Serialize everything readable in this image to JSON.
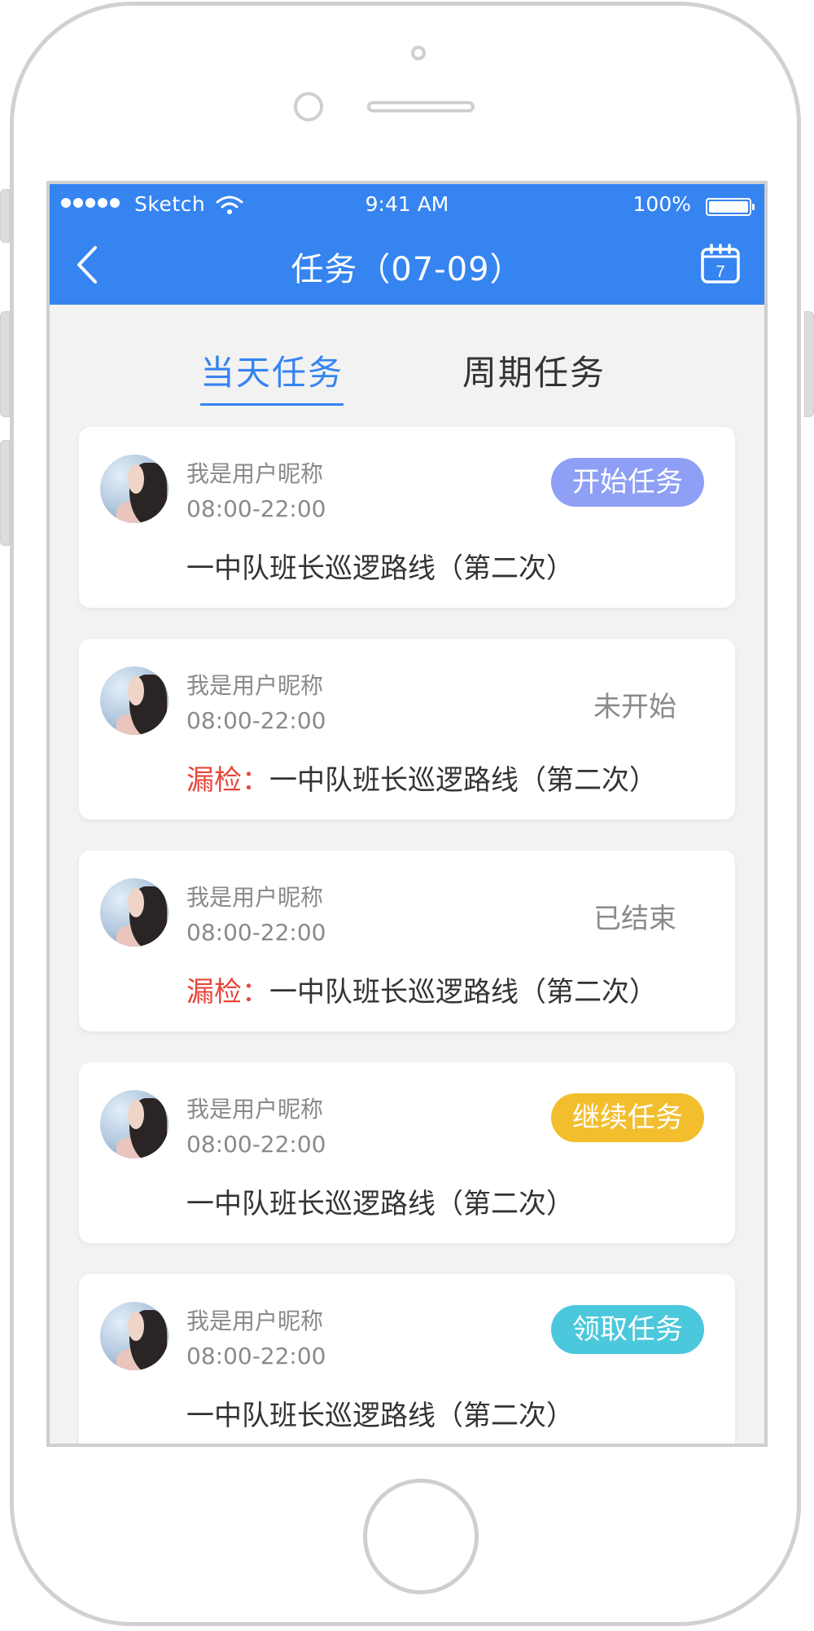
{
  "status_bar": {
    "carrier": "Sketch",
    "time": "9:41 AM",
    "battery": "100%"
  },
  "nav": {
    "title": "任务（07-09）",
    "back_icon": "chevron-left-icon",
    "calendar_icon": "calendar-icon",
    "calendar_day": "7"
  },
  "tabs": [
    {
      "label": "当天任务",
      "active": true
    },
    {
      "label": "周期任务",
      "active": false
    }
  ],
  "colors": {
    "header": "#3584f0",
    "start": "#8e9ff5",
    "continue": "#f2be2e",
    "claim": "#4bc8dc",
    "missed": "#e8463a"
  },
  "tasks": [
    {
      "user": "我是用户昵称",
      "time": "08:00-22:00",
      "route": "一中队班长巡逻路线（第二次）",
      "missed_label": "",
      "action": "开始任务",
      "status": "",
      "action_color": "#8e9ff5"
    },
    {
      "user": "我是用户昵称",
      "time": "08:00-22:00",
      "route": "一中队班长巡逻路线（第二次）",
      "missed_label": "漏检：",
      "action": "",
      "status": "未开始",
      "action_color": ""
    },
    {
      "user": "我是用户昵称",
      "time": "08:00-22:00",
      "route": "一中队班长巡逻路线（第二次）",
      "missed_label": "漏检：",
      "action": "",
      "status": "已结束",
      "action_color": ""
    },
    {
      "user": "我是用户昵称",
      "time": "08:00-22:00",
      "route": "一中队班长巡逻路线（第二次）",
      "missed_label": "",
      "action": "继续任务",
      "status": "",
      "action_color": "#f2be2e"
    },
    {
      "user": "我是用户昵称",
      "time": "08:00-22:00",
      "route": "一中队班长巡逻路线（第二次）",
      "missed_label": "",
      "action": "领取任务",
      "status": "",
      "action_color": "#4bc8dc"
    }
  ]
}
